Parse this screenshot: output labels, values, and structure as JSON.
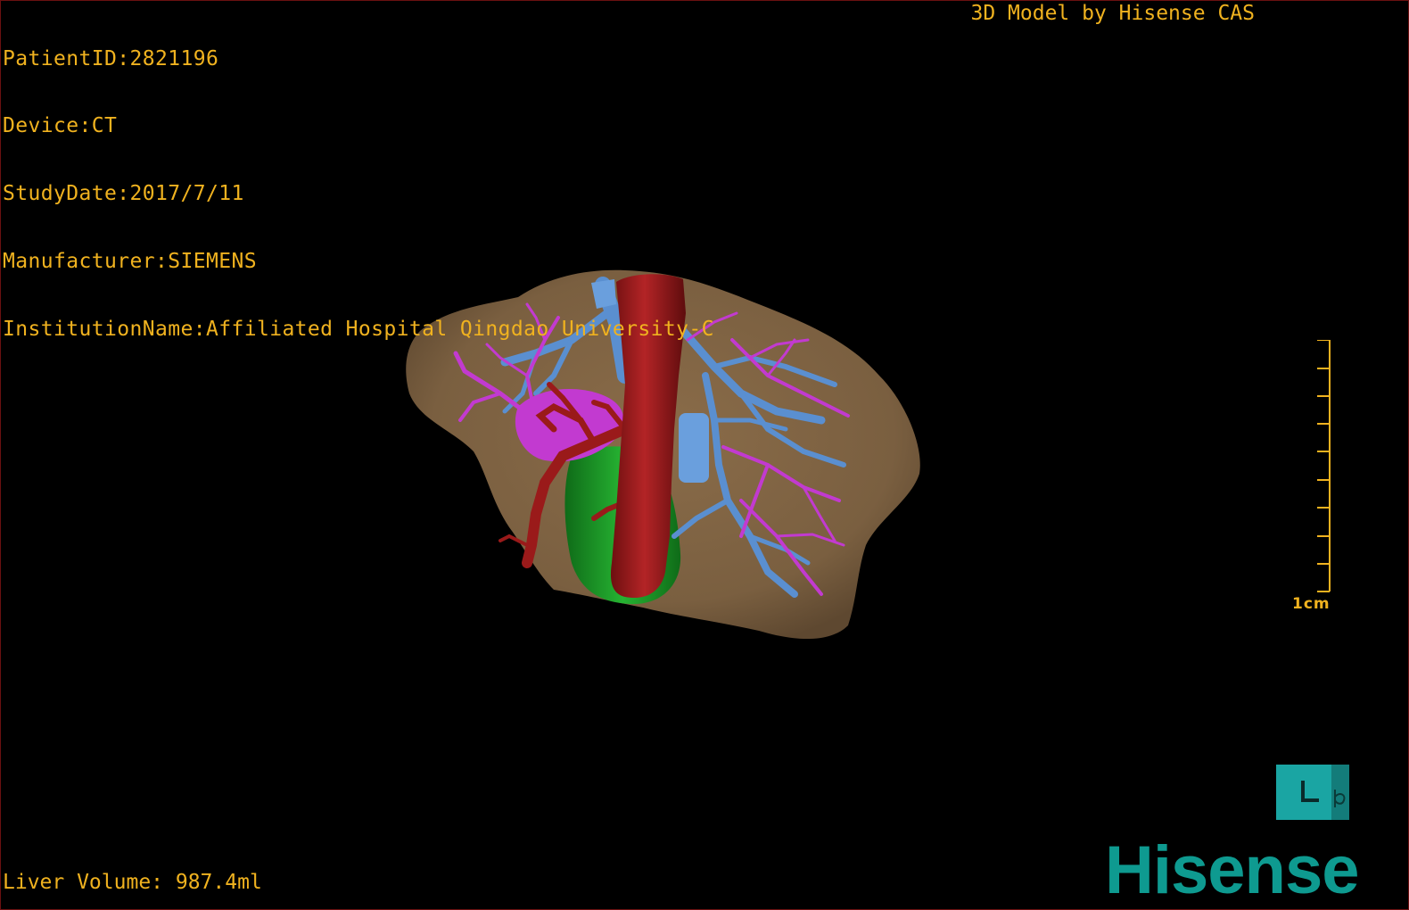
{
  "overlay": {
    "patient_id": "PatientID:2821196",
    "device": "Device:CT",
    "study_date": "StudyDate:2017/7/11",
    "manufacturer": "Manufacturer:SIEMENS",
    "institution": "InstitutionName:Affiliated Hospital Qingdao University-C",
    "credit": "3D Model by Hisense CAS",
    "liver_volume": "Liver Volume: 987.4ml"
  },
  "scale_bar": {
    "label": "1cm"
  },
  "logo": {
    "text": "Hisense"
  },
  "colors": {
    "overlay_text": "#f0b21f",
    "liver": "#806545",
    "portal_vein": "#5a8fd0",
    "hepatic_vein": "#c23ad0",
    "artery": "#9a1a1a",
    "gallbladder": "#1f9b2a",
    "brand": "#0e9a90"
  }
}
